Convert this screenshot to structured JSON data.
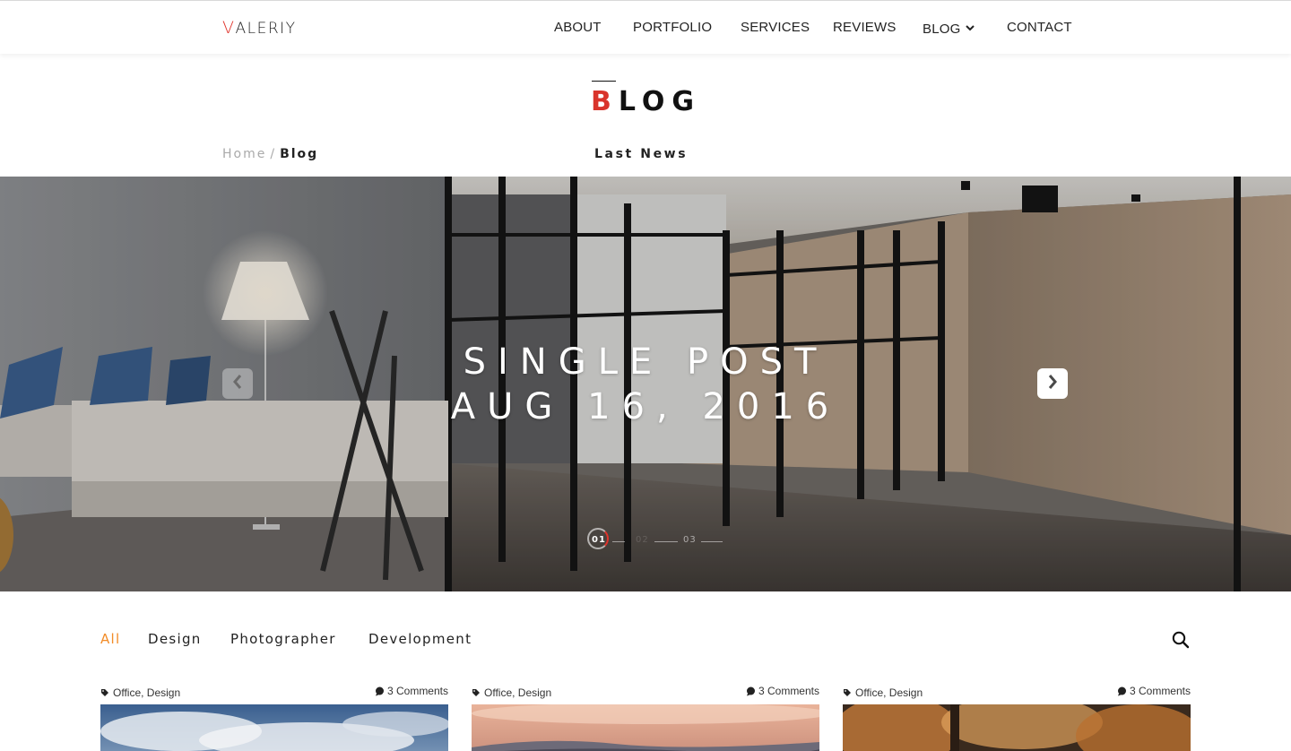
{
  "header": {
    "logo_first": "V",
    "logo_rest": "ALERIY",
    "nav": [
      {
        "label": "ABOUT"
      },
      {
        "label": "PORTFOLIO"
      },
      {
        "label": "SERVICES"
      },
      {
        "label": "REVIEWS"
      },
      {
        "label": "BLOG",
        "has_dropdown": true
      },
      {
        "label": "CONTACT"
      }
    ]
  },
  "page": {
    "title_first": "B",
    "title_rest": "LOG",
    "subtitle": "Last News",
    "breadcrumb": {
      "home": "Home",
      "separator": "/",
      "current": "Blog"
    }
  },
  "slider": {
    "title_line1": "SINGLE POST",
    "title_line2": "AUG 16, 2016",
    "pages": [
      "01",
      "02",
      "03"
    ],
    "active_page": "01",
    "prev_icon": "chevron-left-icon",
    "next_icon": "chevron-right-icon"
  },
  "filters": {
    "items": [
      "All",
      "Design",
      "Photographer",
      "Development"
    ],
    "active": "All",
    "search_icon": "search-icon"
  },
  "posts": [
    {
      "tags": [
        "Office",
        "Design"
      ],
      "comments": "3 Comments"
    },
    {
      "tags": [
        "Office",
        "Design"
      ],
      "comments": "3 Comments"
    },
    {
      "tags": [
        "Office",
        "Design"
      ],
      "comments": "3 Comments"
    }
  ],
  "colors": {
    "accent_red": "#e0332b",
    "accent_orange": "#f28c28",
    "text_dark": "#222222",
    "text_muted": "#aaaaaa"
  }
}
